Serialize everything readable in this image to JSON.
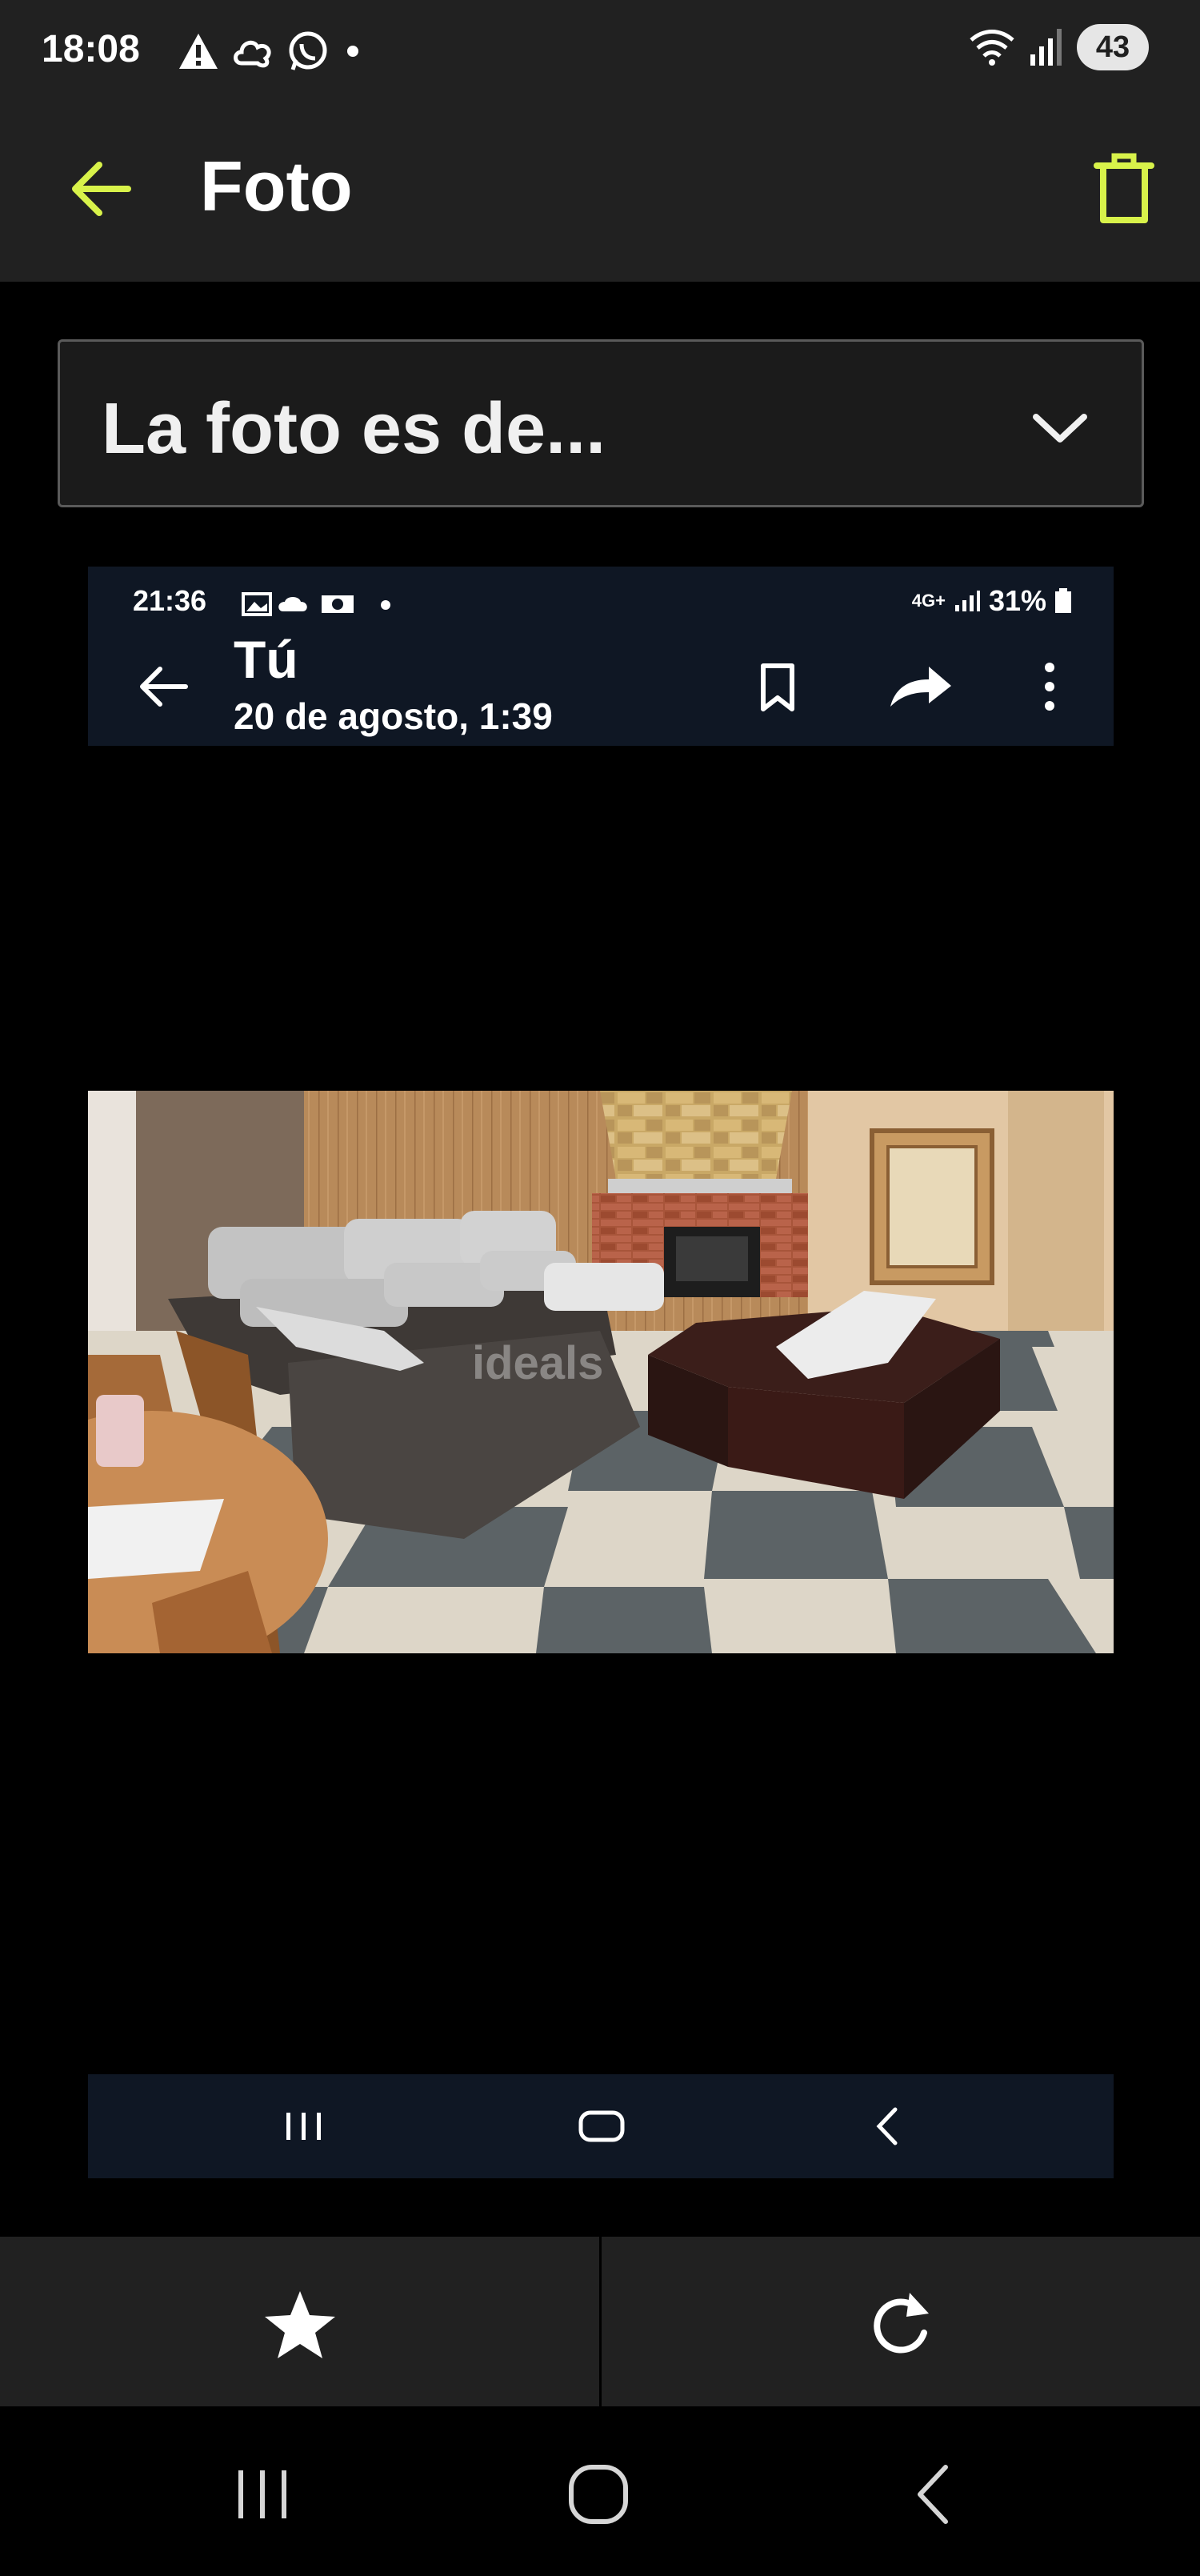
{
  "status_bar": {
    "time": "18:08",
    "battery": "43",
    "icons": [
      "warning-icon",
      "cloud-icon",
      "whatsapp-icon",
      "dot-icon",
      "wifi-icon",
      "signal-icon"
    ]
  },
  "app_bar": {
    "title": "Foto",
    "accent_color": "#d8f24a"
  },
  "dropdown": {
    "value": "La foto es de..."
  },
  "embedded_screenshot": {
    "time": "21:36",
    "network": "4G+",
    "battery": "31%",
    "sender": "Tú",
    "date": "20 de agosto, 1:39",
    "photo_watermark": "ideals"
  },
  "action_bar": {
    "favorite": "star-icon",
    "rotate": "rotate-icon"
  }
}
